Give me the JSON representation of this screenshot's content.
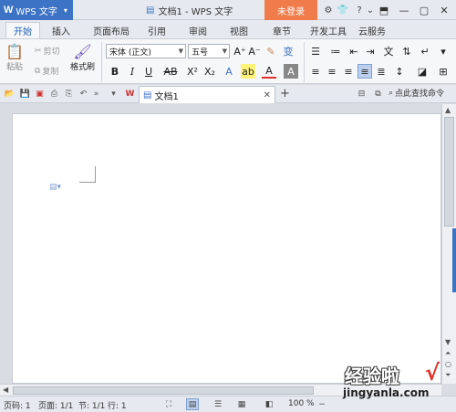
{
  "titlebar": {
    "app_name": "WPS 文字",
    "doc_title": "文档1 - WPS 文字",
    "login_label": "未登录"
  },
  "tabs": [
    "开始",
    "插入",
    "页面布局",
    "引用",
    "审阅",
    "视图",
    "章节",
    "开发工具",
    "云服务"
  ],
  "ribbon": {
    "paste": "粘贴",
    "cut": "剪切",
    "copy": "复制",
    "format_painter": "格式刷",
    "font_name": "宋体 (正文)",
    "font_size": "五号"
  },
  "docbar": {
    "doc_tab": "文档1",
    "search_command": "点此查找命令"
  },
  "status": {
    "page_num": "页码: 1",
    "pages": "页面: 1/1",
    "section": "节: 1/1",
    "row": "行: 1",
    "zoom": "100 %"
  },
  "watermark": {
    "cn": "经验啦",
    "url": "jingyanla.com"
  },
  "colors": {
    "accent": "#3d73c5",
    "login": "#f07c4b"
  }
}
